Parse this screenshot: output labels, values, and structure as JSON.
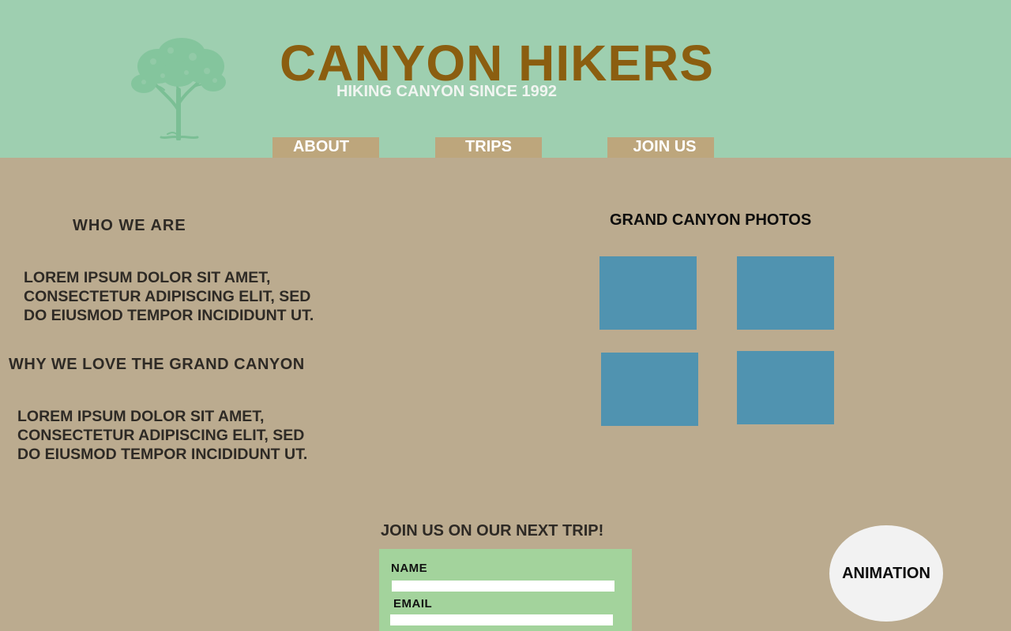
{
  "header": {
    "title": "CANYON HIKERS",
    "tagline": "HIKING CANYON SINCE 1992",
    "logo_icon": "tree-icon",
    "background_color": "#9ecfb0",
    "title_color": "#8b5e10"
  },
  "nav": {
    "items": [
      {
        "label": "ABOUT"
      },
      {
        "label": "TRIPS"
      },
      {
        "label": "JOIN US"
      }
    ],
    "button_color": "#bda67c"
  },
  "about": {
    "who_heading": "WHO WE ARE",
    "who_text": "LOREM IPSUM DOLOR SIT AMET,\nCONSECTETUR ADIPISCING ELIT, SED\nDO EIUSMOD TEMPOR INCIDIDUNT UT.",
    "why_heading": "WHY WE LOVE THE GRAND CANYON",
    "why_text": "LOREM IPSUM DOLOR SIT AMET,\nCONSECTETUR ADIPISCING ELIT, SED\nDO EIUSMOD TEMPOR INCIDIDUNT UT."
  },
  "photos": {
    "heading": "GRAND CANYON PHOTOS",
    "placeholder_color": "#5093b0"
  },
  "signup": {
    "heading": "JOIN US ON OUR NEXT TRIP!",
    "name_label": "NAME",
    "email_label": "EMAIL",
    "name_value": "",
    "email_value": "",
    "form_color": "#a3d39c"
  },
  "animation": {
    "label": "ANIMATION"
  },
  "page": {
    "background_color": "#bbab8f"
  }
}
